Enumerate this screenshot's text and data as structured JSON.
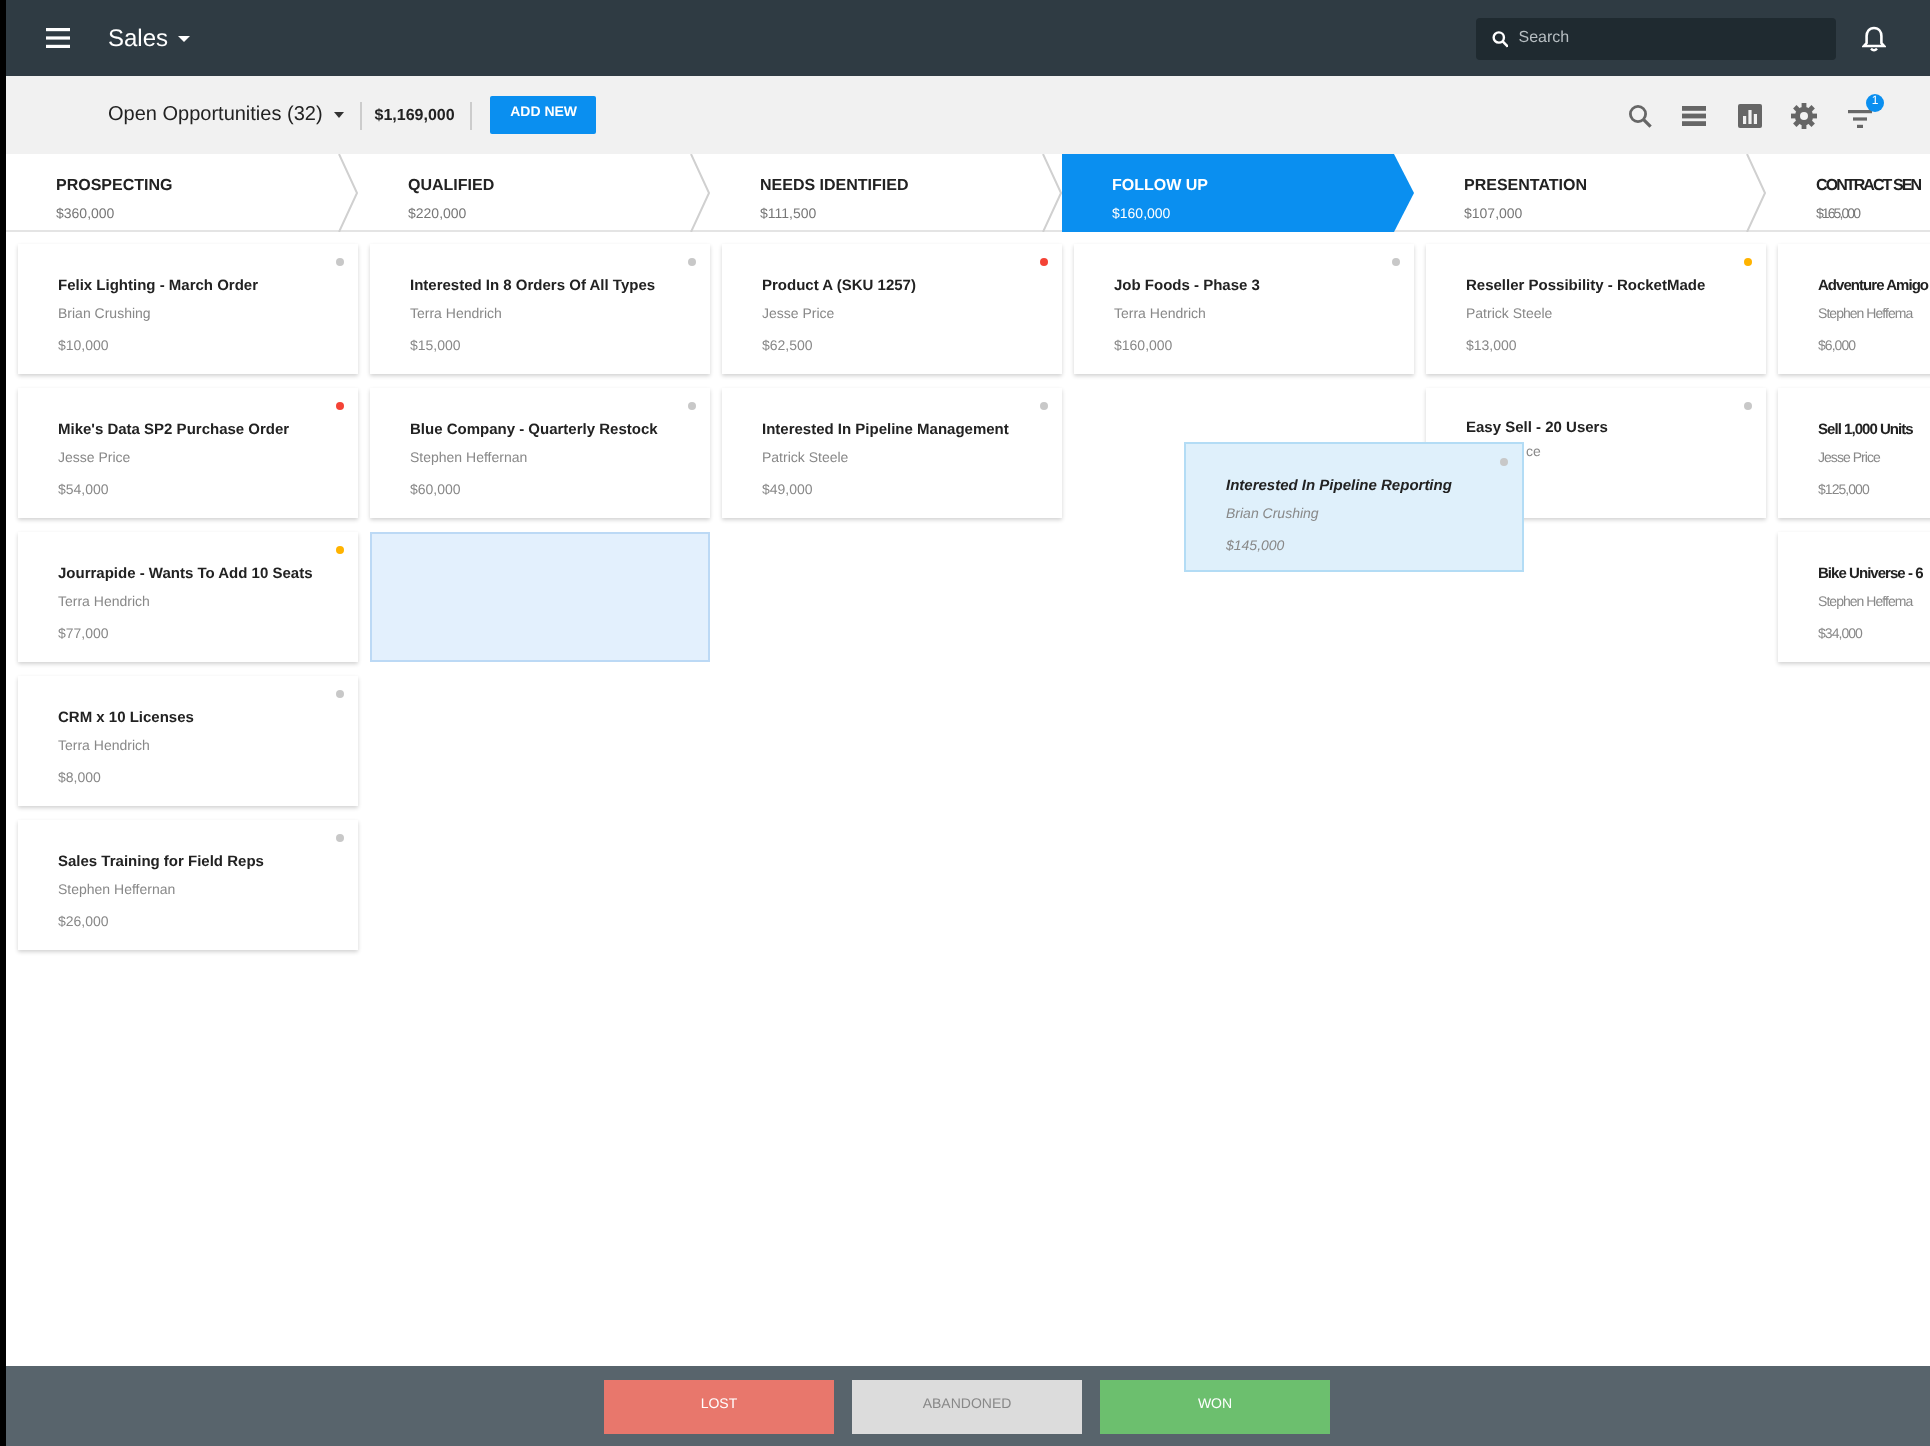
{
  "app_bar": {
    "title": "Sales",
    "search": {
      "placeholder": "Search"
    }
  },
  "toolbar": {
    "view": "Open Opportunities (32)",
    "total": "$1,169,000",
    "add_button": "ADD NEW",
    "filter_badge": "1"
  },
  "stages": [
    {
      "name": "PROSPECTING",
      "amount": "$360,000",
      "selected": false,
      "cards": [
        {
          "title": "Felix Lighting - March Order",
          "person": "Brian Crushing",
          "amount": "$10,000",
          "color": "#c8c8c8"
        },
        {
          "title": "Mike's Data SP2 Purchase Order",
          "person": "Jesse Price",
          "amount": "$54,000",
          "color": "#f44336"
        },
        {
          "title": "Jourrapide - Wants To Add 10 Seats",
          "person": "Terra Hendrich",
          "amount": "$77,000",
          "color": "#ffb300"
        },
        {
          "title": "CRM x 10 Licenses",
          "person": "Terra Hendrich",
          "amount": "$8,000",
          "color": "#c8c8c8"
        },
        {
          "title": "Sales Training for Field Reps",
          "person": "Stephen Heffernan",
          "amount": "$26,000",
          "color": "#c8c8c8"
        }
      ]
    },
    {
      "name": "QUALIFIED",
      "amount": "$220,000",
      "selected": false,
      "drop_target": true,
      "cards": [
        {
          "title": "Interested In 8 Orders Of All Types",
          "person": "Terra Hendrich",
          "amount": "$15,000",
          "color": "#c8c8c8"
        },
        {
          "title": "Blue Company - Quarterly Restock",
          "person": "Stephen Heffernan",
          "amount": "$60,000",
          "color": "#c8c8c8"
        }
      ]
    },
    {
      "name": "NEEDS IDENTIFIED",
      "amount": "$111,500",
      "selected": false,
      "cards": [
        {
          "title": "Product A (SKU 1257)",
          "person": "Jesse Price",
          "amount": "$62,500",
          "color": "#f44336"
        },
        {
          "title": "Interested In Pipeline Management",
          "person": "Patrick Steele",
          "amount": "$49,000",
          "color": "#c8c8c8"
        }
      ]
    },
    {
      "name": "FOLLOW UP",
      "amount": "$160,000",
      "selected": true,
      "cards": [
        {
          "title": "Job Foods - Phase 3",
          "person": "Terra Hendrich",
          "amount": "$160,000",
          "color": "#c8c8c8"
        }
      ]
    },
    {
      "name": "PRESENTATION",
      "amount": "$107,000",
      "selected": false,
      "cards": [
        {
          "title": "Reseller Possibility - RocketMade",
          "person": "Patrick Steele",
          "amount": "$13,000",
          "color": "#ffb300"
        },
        {
          "title": "Easy Sell - 20 Users",
          "person": "ce",
          "partial": true,
          "color": "#c8c8c8"
        }
      ]
    },
    {
      "name": "CONTRACT SEN",
      "amount": "$165,000",
      "selected": false,
      "cut": true,
      "cards": [
        {
          "title": "Adventure Amigo",
          "person": "Stephen Heffema",
          "amount": "$6,000"
        },
        {
          "title": "Sell 1,000 Units",
          "person": "Jesse Price",
          "amount": "$125,000"
        },
        {
          "title": "Bike Universe - 6",
          "person": "Stephen Heffema",
          "amount": "$34,000"
        }
      ]
    }
  ],
  "dragged_card": {
    "title": "Interested In Pipeline Reporting",
    "person": "Brian Crushing",
    "amount": "$145,000",
    "color": "#c8c8c8"
  },
  "outcomes": [
    {
      "label": "LOST",
      "kind": "lost"
    },
    {
      "label": "ABANDONED",
      "kind": "abandoned"
    },
    {
      "label": "WON",
      "kind": "won"
    }
  ]
}
